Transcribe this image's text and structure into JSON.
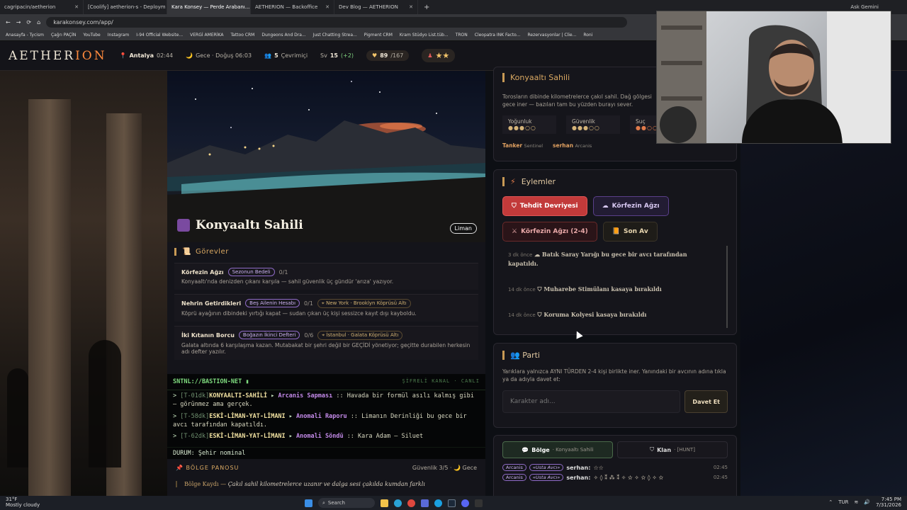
{
  "browser": {
    "tabs": [
      {
        "label": "cagripacin/aetherion",
        "active": false
      },
      {
        "label": "[Coolify] aetherion-s - Deploym",
        "active": false
      },
      {
        "label": "Kara Konsey — Perde Arabanı...",
        "active": true
      },
      {
        "label": "AETHERION — Backoffice",
        "active": false
      },
      {
        "label": "Dev Blog — AETHERION",
        "active": false
      }
    ],
    "profile": "Ask Gemini",
    "url": "karakonsey.com/app/",
    "bookmarks": [
      "Anasayfa - Tycism",
      "Çağrı PAÇİN",
      "YouTube",
      "Instagram",
      "I-94 Official Website...",
      "VERGİ AMERİKA",
      "Tattoo CRM",
      "Dungeons And Dra...",
      "Just Chatting Strea...",
      "Pigment CRM",
      "Kram Stüdyo List.tüb...",
      "TRON",
      "Cleopatra INK Facto...",
      "Rezervasyonlar | Clie...",
      "Roni"
    ]
  },
  "header": {
    "logo_a": "AETHER",
    "logo_b": "ION",
    "city": "Antalya",
    "city_time": "02:44",
    "phase": "Gece · Doğuş 06:03",
    "online_count": "5",
    "online_label": "Çevrimiçi",
    "level_label": "Sv",
    "level": "15",
    "level_bonus": "(+2)",
    "hp": "89",
    "hp_max": "/167",
    "stars": "★★"
  },
  "scene": {
    "title": "Konyaaltı Sahili",
    "badge": "Liman"
  },
  "quests": {
    "title": "Görevler",
    "items": [
      {
        "name": "Körfezin Ağzı",
        "tag": "Sezonun Bedeli",
        "progress": "0/1",
        "location": "",
        "desc": "Konyaaltı'nda denizden çıkanı karşıla — sahil güvenlik üç gündür 'arıza' yazıyor."
      },
      {
        "name": "Nehrin Getirdikleri",
        "tag": "Beş Ailenin Hesabı",
        "progress": "0/1",
        "location": "New York · Brooklyn Köprüsü Altı",
        "desc": "Köprü ayağının dibindeki yırtığı kapat — sudan çıkan üç kişi sessizce kayıt dışı kayboldu."
      },
      {
        "name": "İki Kıtanın Borcu",
        "tag": "Boğazın İkinci Defteri",
        "progress": "0/6",
        "location": "İstanbul · Galata Köprüsü Altı",
        "desc": "Galata altında 6 karşılaşma kazan. Mutabakat bir şehri değil bir GEÇİDİ yönetiyor; geçitte durabilen herkesin adı defter yazılır."
      }
    ]
  },
  "terminal": {
    "title": "SNTNL://BASTION-NET ▮",
    "status_right": "ŞİFRELİ KANAL · CANLI",
    "lines": [
      {
        "ts": "[T-01dk]",
        "loc": "KONYAALTI-SAHİLİ",
        "event": "Arcanis Sapması",
        "msg": ":: Havada bir formül asılı kalmış gibi — görünmez ama gerçek."
      },
      {
        "ts": "[T-58dk]",
        "loc": "ESKİ-LİMAN-YAT-LİMANI",
        "event": "Anomali Raporu",
        "msg": ":: Limanın Derinliği bu gece bir avcı tarafından kapatıldı."
      },
      {
        "ts": "[T-62dk]",
        "loc": "ESKİ-LİMAN-YAT-LİMANI",
        "event": "Anomali Söndü",
        "msg": ":: Kara Adam — Siluet"
      }
    ],
    "status": "DURUM: Şehir nominal"
  },
  "board": {
    "title": "BÖLGE PANOSU",
    "right": "Güvenlik 3/5 · 🌙 Gece",
    "log_label": "Bölge Kaydı —",
    "log_text": "Çakıl sahil kilometrelerce uzanır ve dalga sesi çakılda kumdan farklı"
  },
  "location": {
    "title": "Konyaaltı Sahili",
    "desc": "Torosların dibinde kilometrelerce çakıl sahil. Dağ gölgesi gece iner — bazıları tam bu yüzden burayı sever.",
    "stats": [
      {
        "label": "Yoğunluk",
        "dots": "●●●○○",
        "red": false
      },
      {
        "label": "Güvenlik",
        "dots": "●●●○○",
        "red": false
      },
      {
        "label": "Suç",
        "dots": "●●○○○",
        "red": true
      }
    ],
    "npcs": [
      {
        "name": "Tanker",
        "cls": "Sentinel"
      },
      {
        "name": "serhan",
        "cls": "Arcanis"
      }
    ]
  },
  "actions": {
    "title": "Eylemler",
    "buttons": [
      "Tehdit Devriyesi",
      "Körfezin Ağzı",
      "Körfezin Ağzı (2-4)",
      "Son Av"
    ],
    "feed": [
      {
        "ago": "3 dk önce",
        "text": "Batık Saray Yarığı bu gece bir avcı tarafından kapatıldı."
      },
      {
        "ago": "14 dk önce",
        "text": "Muharebe Stimülanı kasaya bırakıldı"
      },
      {
        "ago": "14 dk önce",
        "text": "Koruma Kolyesi kasaya bırakıldı"
      }
    ]
  },
  "party": {
    "title": "Parti",
    "desc": "Yarıklara yalnızca AYNI TÜRDEN 2-4 kişi birlikte iner. Yanındaki bir avcının adına tıkla ya da adıyla davet et:",
    "placeholder": "Karakter adı...",
    "invite": "Davet Et"
  },
  "chat": {
    "tabs": [
      {
        "label": "Bölge",
        "sub": "· Konyaaltı Sahili"
      },
      {
        "label": "Klan",
        "sub": "· [HUNT]"
      }
    ],
    "messages": [
      {
        "class": "Arcanis",
        "rank": "«Usta Avcı»",
        "user": "serhan:",
        "text": "☆☆",
        "time": "02:45"
      },
      {
        "class": "Arcanis",
        "rank": "«Usta Avcı»",
        "user": "serhan:",
        "text": "✧ ◊ ⁑ ⁂ ⁑ ✧ ✫ ✧ ✫ ◊ ✧ ✫",
        "time": "02:45"
      }
    ]
  },
  "taskbar": {
    "weather_temp": "31°F",
    "weather_desc": "Mostly cloudy",
    "search": "Search",
    "lang": "TUR",
    "time": "7:45 PM",
    "date": "7/31/2026"
  }
}
